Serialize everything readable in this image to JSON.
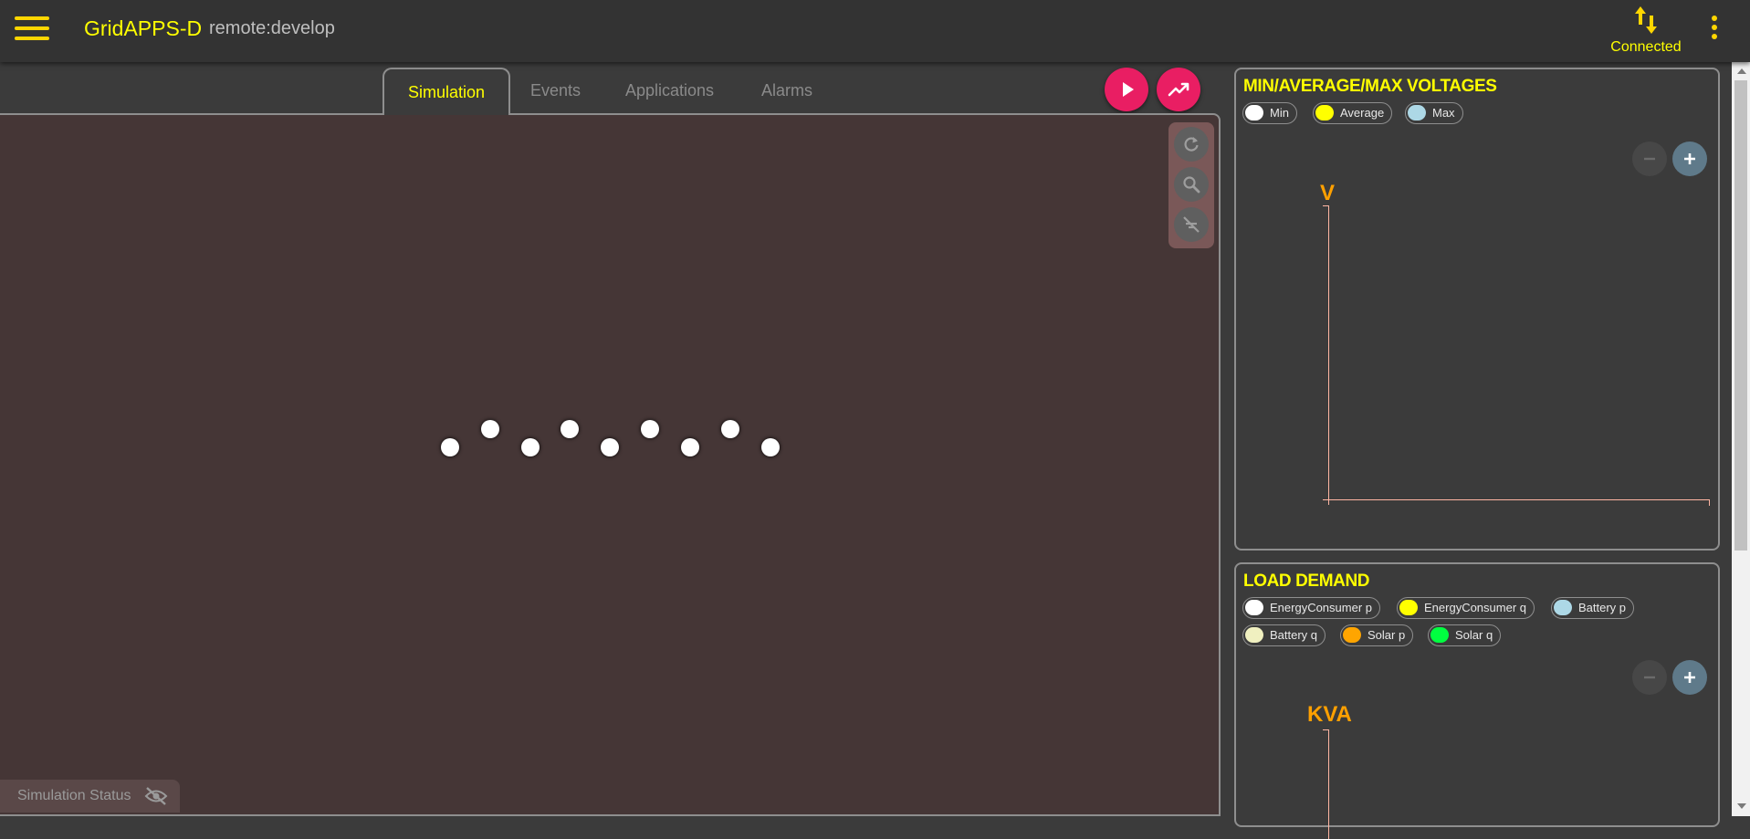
{
  "header": {
    "app_title": "GridAPPS-D",
    "subtitle": "remote:develop",
    "connection_status": "Connected"
  },
  "tabs": [
    {
      "label": "Simulation",
      "active": true
    },
    {
      "label": "Events",
      "active": false
    },
    {
      "label": "Applications",
      "active": false
    },
    {
      "label": "Alarms",
      "active": false
    }
  ],
  "actions": {
    "start_simulation_icon": "play-icon",
    "plots_icon": "trending-up-icon"
  },
  "canvas": {
    "node_count": 9,
    "tools": [
      "refresh-icon",
      "search-icon",
      "toggle-labels-off-icon"
    ],
    "status_toggle_label": "Simulation Status",
    "status_toggle_icon": "eye-off-icon"
  },
  "panels": {
    "voltages": {
      "title": "MIN/AVERAGE/MAX VOLTAGES",
      "legend": [
        {
          "label": "Min",
          "color": "#ffffff"
        },
        {
          "label": "Average",
          "color": "#ffff00"
        },
        {
          "label": "Max",
          "color": "#add8e6"
        }
      ],
      "y_label": "V"
    },
    "load_demand": {
      "title": "LOAD DEMAND",
      "legend": [
        {
          "label": "EnergyConsumer p",
          "color": "#ffffff"
        },
        {
          "label": "EnergyConsumer q",
          "color": "#ffff00"
        },
        {
          "label": "Battery p",
          "color": "#add8e6"
        },
        {
          "label": "Battery q",
          "color": "#f0f0c0"
        },
        {
          "label": "Solar p",
          "color": "#ffa500"
        },
        {
          "label": "Solar q",
          "color": "#00ff40"
        }
      ],
      "y_label": "KVA"
    }
  },
  "colors": {
    "accent_yellow": "#ffff00",
    "fab_pink": "#e91e63",
    "canvas_bg": "#453636",
    "axis_color": "#ffb6a3",
    "axis_label_color": "#ffa000"
  }
}
